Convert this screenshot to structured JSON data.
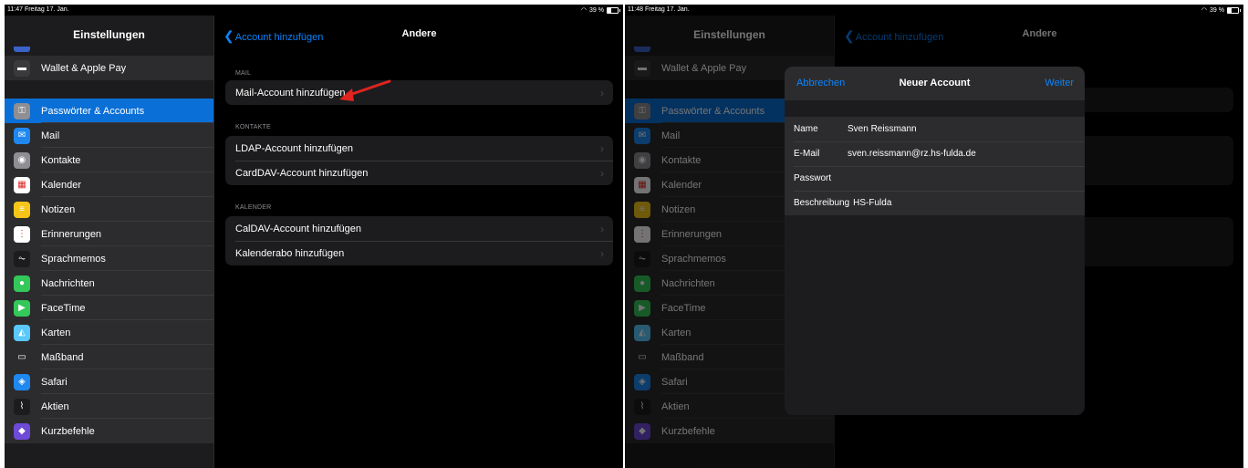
{
  "left": {
    "status": {
      "time": "11:47  Freitag 17. Jan.",
      "battery": "39 %"
    },
    "sidebar": {
      "title": "Einstellungen",
      "group1": [
        {
          "label": "Wallet & Apple Pay",
          "icon": "wallet-icon",
          "color": "#3a3a3c"
        }
      ],
      "group2": [
        {
          "label": "Passwörter & Accounts",
          "icon": "key-icon",
          "color": "#8e8e93",
          "glyph": "⚿"
        },
        {
          "label": "Mail",
          "icon": "mail-icon",
          "color": "#1e88f0",
          "glyph": "✉"
        },
        {
          "label": "Kontakte",
          "icon": "contacts-icon",
          "color": "#8e8e93",
          "glyph": "◉"
        },
        {
          "label": "Kalender",
          "icon": "calendar-icon",
          "color": "#ffffff",
          "glyph": "▦"
        },
        {
          "label": "Notizen",
          "icon": "notes-icon",
          "color": "#f5c518",
          "glyph": "≡"
        },
        {
          "label": "Erinnerungen",
          "icon": "reminders-icon",
          "color": "#ffffff",
          "glyph": "⋮"
        },
        {
          "label": "Sprachmemos",
          "icon": "voice-memos-icon",
          "color": "#1c1c1e",
          "glyph": "⏦"
        },
        {
          "label": "Nachrichten",
          "icon": "messages-icon",
          "color": "#34c759",
          "glyph": "●"
        },
        {
          "label": "FaceTime",
          "icon": "facetime-icon",
          "color": "#34c759",
          "glyph": "▶"
        },
        {
          "label": "Karten",
          "icon": "maps-icon",
          "color": "#5ac8fa",
          "glyph": "◭"
        },
        {
          "label": "Maßband",
          "icon": "measure-icon",
          "color": "#2c2c2e",
          "glyph": "▭"
        },
        {
          "label": "Safari",
          "icon": "safari-icon",
          "color": "#1e88f0",
          "glyph": "◈"
        },
        {
          "label": "Aktien",
          "icon": "stocks-icon",
          "color": "#1c1c1e",
          "glyph": "⌇"
        },
        {
          "label": "Kurzbefehle",
          "icon": "shortcuts-icon",
          "color": "#6e4ad8",
          "glyph": "◆"
        }
      ]
    },
    "detail": {
      "back_label": "Account hinzufügen",
      "title": "Andere",
      "sections": [
        {
          "header": "MAIL",
          "rows": [
            "Mail-Account hinzufügen"
          ]
        },
        {
          "header": "KONTAKTE",
          "rows": [
            "LDAP-Account hinzufügen",
            "CardDAV-Account hinzufügen"
          ]
        },
        {
          "header": "KALENDER",
          "rows": [
            "CalDAV-Account hinzufügen",
            "Kalenderabo hinzufügen"
          ]
        }
      ]
    },
    "annotation_color": "#e0241f"
  },
  "right": {
    "status": {
      "time": "11:48  Freitag 17. Jan.",
      "battery": "39 %"
    },
    "modal": {
      "cancel_label": "Abbrechen",
      "title": "Neuer Account",
      "next_label": "Weiter",
      "fields": [
        {
          "label": "Name",
          "value": "Sven Reissmann"
        },
        {
          "label": "E-Mail",
          "value": "sven.reissmann@rz.hs-fulda.de"
        },
        {
          "label": "Passwort",
          "value": ""
        },
        {
          "label": "Beschreibung",
          "value": "HS-Fulda"
        }
      ]
    }
  },
  "colors": {
    "accent": "#0a84ff",
    "selected": "#0a6fd6"
  }
}
